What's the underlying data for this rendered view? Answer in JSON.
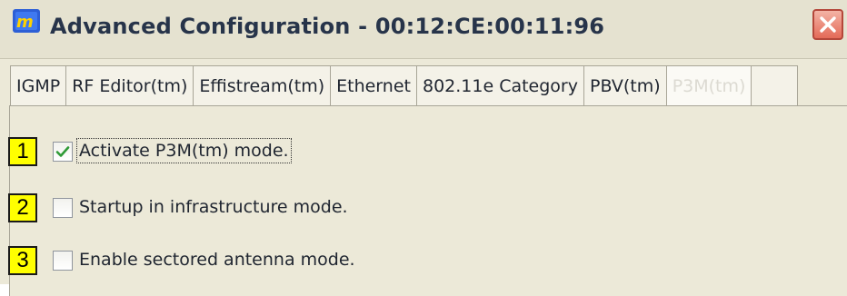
{
  "window": {
    "title": "Advanced Configuration - 00:12:CE:00:11:96"
  },
  "tabs": [
    {
      "label": "IGMP"
    },
    {
      "label": "RF Editor(tm)"
    },
    {
      "label": "Effistream(tm)"
    },
    {
      "label": "Ethernet"
    },
    {
      "label": "802.11e Category"
    },
    {
      "label": "PBV(tm)"
    },
    {
      "label": "P3M(tm)"
    }
  ],
  "options": [
    {
      "marker": "1",
      "label": "Activate P3M(tm) mode.",
      "checked": true
    },
    {
      "marker": "2",
      "label": "Startup in infrastructure mode.",
      "checked": false
    },
    {
      "marker": "3",
      "label": "Enable sectored antenna mode.",
      "checked": false
    }
  ],
  "colors": {
    "highlight": "#ffff00",
    "close_button": "#e46a58",
    "checkmark": "#2e9a35"
  },
  "icons": [
    "app-icon",
    "close-icon",
    "checkmark-icon"
  ]
}
